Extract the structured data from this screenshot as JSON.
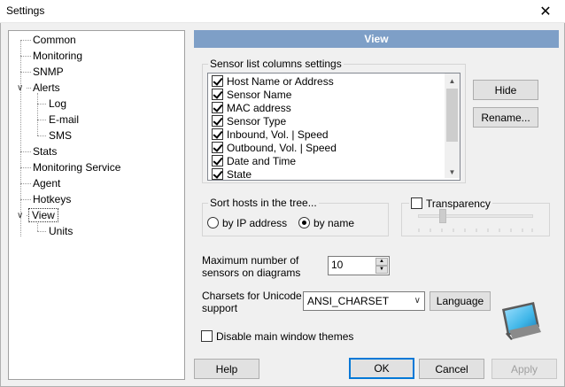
{
  "window": {
    "title": "Settings",
    "close_glyph": "✕"
  },
  "tree": {
    "items": [
      {
        "label": "Common"
      },
      {
        "label": "Monitoring"
      },
      {
        "label": "SNMP"
      },
      {
        "label": "Alerts"
      },
      {
        "label": "Log"
      },
      {
        "label": "E-mail"
      },
      {
        "label": "SMS"
      },
      {
        "label": "Stats"
      },
      {
        "label": "Monitoring Service"
      },
      {
        "label": "Agent"
      },
      {
        "label": "Hotkeys"
      },
      {
        "label": "View"
      },
      {
        "label": "Units"
      }
    ],
    "selected": "View"
  },
  "panel": {
    "header": "View",
    "sensor_columns": {
      "title": "Sensor list columns settings",
      "items": [
        {
          "label": "Host Name or Address",
          "checked": true
        },
        {
          "label": "Sensor Name",
          "checked": true
        },
        {
          "label": "MAC address",
          "checked": true
        },
        {
          "label": "Sensor Type",
          "checked": true
        },
        {
          "label": "Inbound, Vol. | Speed",
          "checked": true
        },
        {
          "label": "Outbound, Vol. | Speed",
          "checked": true
        },
        {
          "label": "Date and Time",
          "checked": true
        },
        {
          "label": "State",
          "checked": true
        }
      ],
      "hide_label": "Hide",
      "rename_label": "Rename..."
    },
    "sort": {
      "title": "Sort hosts in the tree...",
      "option_ip": "by IP address",
      "option_name": "by name",
      "selected": "by name"
    },
    "transparency": {
      "label": "Transparency",
      "checked": false
    },
    "max_sensors": {
      "label_line1": "Maximum number of",
      "label_line2": "sensors on diagrams",
      "value": "10"
    },
    "charsets": {
      "label_line1": "Charsets for Unicode",
      "label_line2": "support",
      "value": "ANSI_CHARSET",
      "language_label": "Language"
    },
    "disable_themes": {
      "label": "Disable main window themes",
      "checked": false
    }
  },
  "buttons": {
    "help": "Help",
    "ok": "OK",
    "cancel": "Cancel",
    "apply": "Apply"
  },
  "colors": {
    "header_bg": "#7e9fc7",
    "default_btn_border": "#0078d7"
  }
}
